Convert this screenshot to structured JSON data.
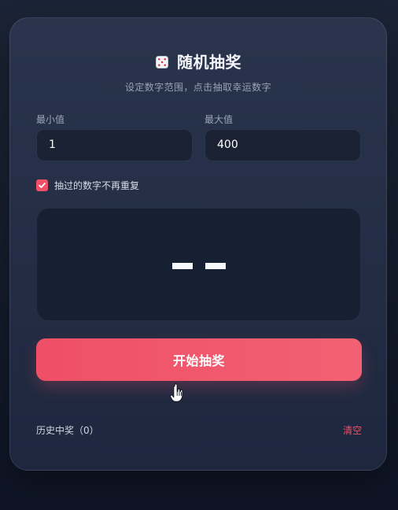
{
  "header": {
    "title": "随机抽奖",
    "subtitle": "设定数字范围，点击抽取幸运数字"
  },
  "range": {
    "min_label": "最小值",
    "min_value": "1",
    "max_label": "最大值",
    "max_value": "400"
  },
  "options": {
    "no_repeat_label": "抽过的数字不再重复",
    "no_repeat_checked": true
  },
  "result": {
    "display_text": "--"
  },
  "actions": {
    "draw_label": "开始抽奖",
    "clear_label": "清空"
  },
  "history": {
    "label": "历史中奖（0）"
  },
  "icons": {
    "title_icon": "dice-icon",
    "checkbox_icon": "checkmark-icon",
    "cursor_icon": "pointer-hand-icon"
  },
  "colors": {
    "accent": "#ef4f67",
    "card": "#2d3a56",
    "field": "#1a2233",
    "text_primary": "#ffffff",
    "text_secondary": "#98a2b7"
  }
}
